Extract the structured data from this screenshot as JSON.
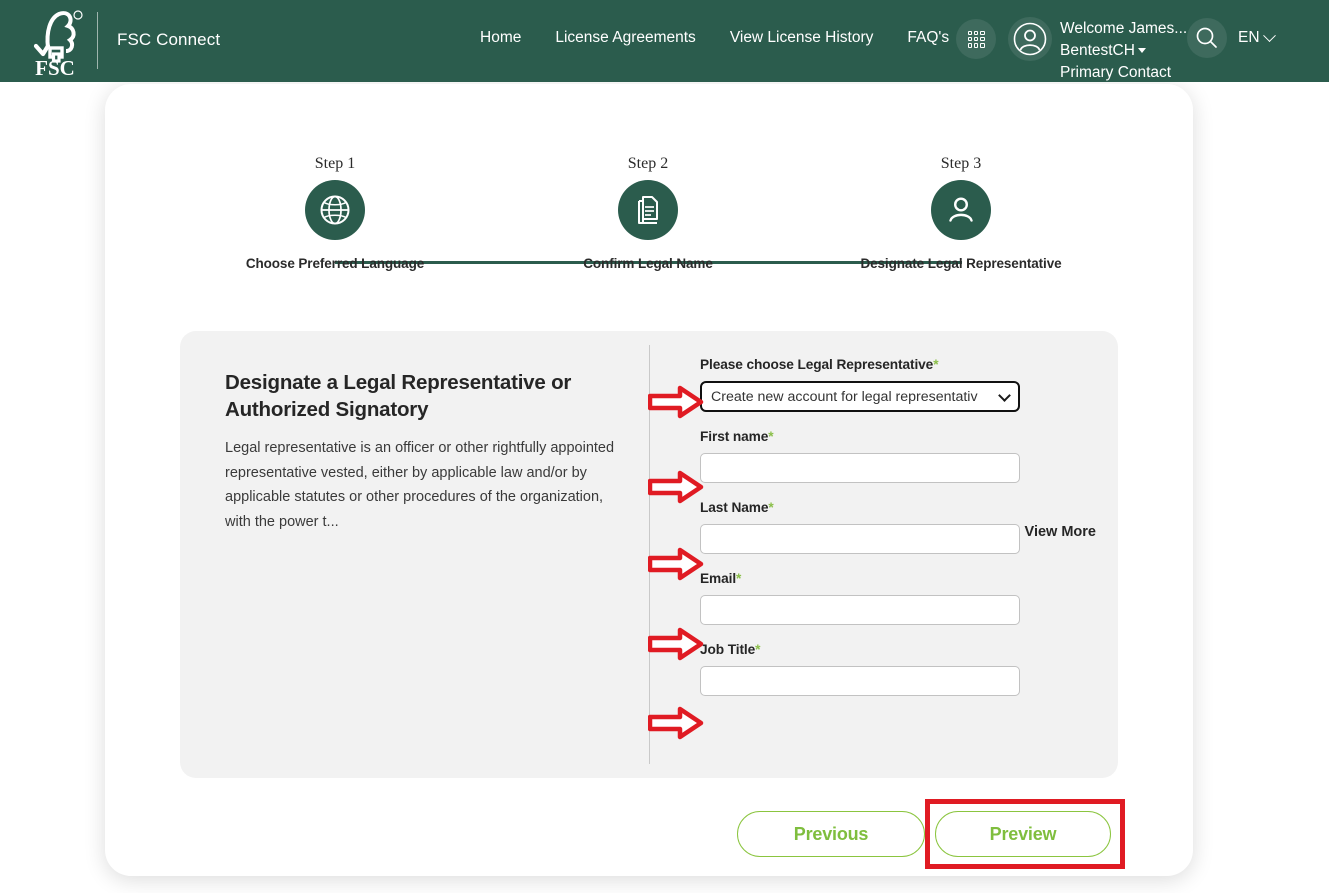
{
  "header": {
    "brand": "FSC Connect",
    "logo_name": "fsc-logo",
    "nav": [
      {
        "label": "Home",
        "name": "nav-home"
      },
      {
        "label": "License Agreements",
        "name": "nav-license-agreements"
      },
      {
        "label": "View License History",
        "name": "nav-view-license-history"
      },
      {
        "label": "FAQ's",
        "name": "nav-faqs"
      }
    ],
    "apps_icon": "apps-grid-icon",
    "avatar_icon": "user-avatar-icon",
    "search_icon": "search-icon",
    "user": {
      "line1": "Welcome James...",
      "line2": "BentestCH",
      "line3": "Primary Contact"
    },
    "language": "EN"
  },
  "stepper": {
    "steps": [
      {
        "num": "Step 1",
        "label": "Choose Preferred Language",
        "icon": "globe-icon"
      },
      {
        "num": "Step 2",
        "label": "Confirm Legal Name",
        "icon": "document-icon"
      },
      {
        "num": "Step 3",
        "label": "Designate Legal Representative",
        "icon": "person-icon"
      }
    ]
  },
  "panel": {
    "title": "Designate a Legal Representative or Authorized Signatory",
    "body": "Legal representative is an officer or other rightfully appointed representative vested, either by applicable law and/or by applicable statutes or other procedures of the organization, with the power t...",
    "view_more": "View More"
  },
  "form": {
    "select": {
      "label": "Please choose Legal Representative",
      "required_mark": "*",
      "value": "Create new account for legal representativ",
      "options": [
        "Create new account for legal representativ"
      ]
    },
    "fields": [
      {
        "label": "First name",
        "required_mark": "*",
        "value": "",
        "placeholder": "",
        "name": "first-name-input"
      },
      {
        "label": "Last Name",
        "required_mark": "*",
        "value": "",
        "placeholder": "",
        "name": "last-name-input"
      },
      {
        "label": "Email",
        "required_mark": "*",
        "value": "",
        "placeholder": "",
        "name": "email-input"
      },
      {
        "label": "Job Title",
        "required_mark": "*",
        "value": "",
        "placeholder": "",
        "name": "job-title-input"
      }
    ]
  },
  "footer": {
    "previous": "Previous",
    "preview": "Preview"
  },
  "colors": {
    "header_green": "#2b5c4d",
    "accent_green": "#8bc53f",
    "annotation_red": "#e01b23",
    "panel_grey": "#f2f2f2"
  }
}
